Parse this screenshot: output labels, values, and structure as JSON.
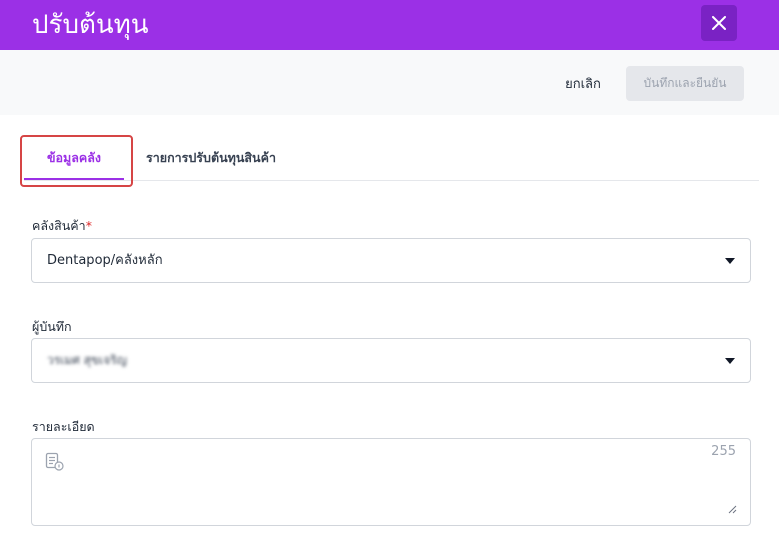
{
  "header": {
    "title": "ปรับต้นทุน",
    "close_icon": "close-icon",
    "brand_color": "#9b30e6"
  },
  "toolbar": {
    "cancel_label": "ยกเลิก",
    "confirm_label": "บันทึกและยืนยัน"
  },
  "tabs": [
    {
      "label": "ข้อมูลคลัง",
      "active": true
    },
    {
      "label": "รายการปรับต้นทุนสินค้า",
      "active": false
    }
  ],
  "form": {
    "warehouse": {
      "label": "คลังสินค้า",
      "required_mark": "*",
      "value": "Dentapop/คลังหลัก"
    },
    "recorder": {
      "label": "ผู้บันทึก",
      "value": "วรเมศ สุขเจริญ"
    },
    "details": {
      "label": "รายละเอียด",
      "value": "",
      "counter": "255",
      "icon": "note-icon"
    }
  }
}
